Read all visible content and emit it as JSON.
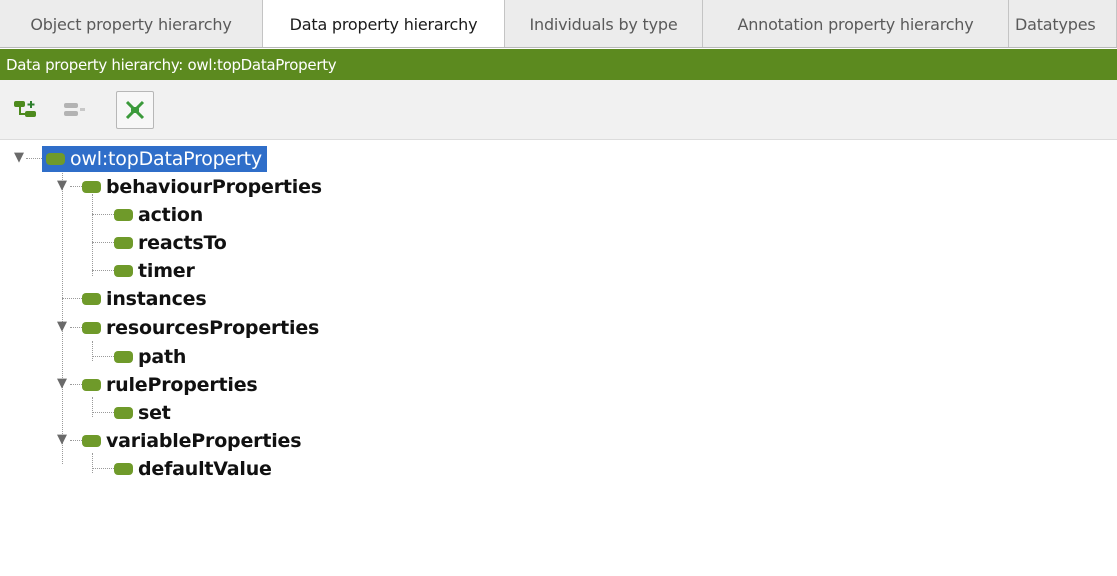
{
  "tabs": [
    {
      "label": "Object property hierarchy",
      "active": false
    },
    {
      "label": "Data property hierarchy",
      "active": true
    },
    {
      "label": "Individuals by type",
      "active": false
    },
    {
      "label": "Annotation property hierarchy",
      "active": false
    },
    {
      "label": "Datatypes",
      "active": false
    }
  ],
  "view": {
    "title": "Data property hierarchy: owl:topDataProperty"
  },
  "toolbar": {
    "buttons": [
      {
        "icon": "add-subproperty-icon",
        "enabled": true
      },
      {
        "icon": "add-sibling-property-icon",
        "enabled": false
      },
      {
        "icon": "delete-property-icon",
        "enabled": true
      }
    ]
  },
  "tree": {
    "root": "owl:topDataProperty",
    "nodes": {
      "behaviourProperties": "behaviourProperties",
      "action": "action",
      "reactsTo": "reactsTo",
      "timer": "timer",
      "instances": "instances",
      "resourcesProperties": "resourcesProperties",
      "path": "path",
      "ruleProperties": "ruleProperties",
      "set": "set",
      "variableProperties": "variableProperties",
      "defaultValue": "defaultValue"
    }
  },
  "colors": {
    "accent_green": "#5c8a1f",
    "property_icon": "#6f9a2a",
    "selection": "#2f6ec9"
  }
}
